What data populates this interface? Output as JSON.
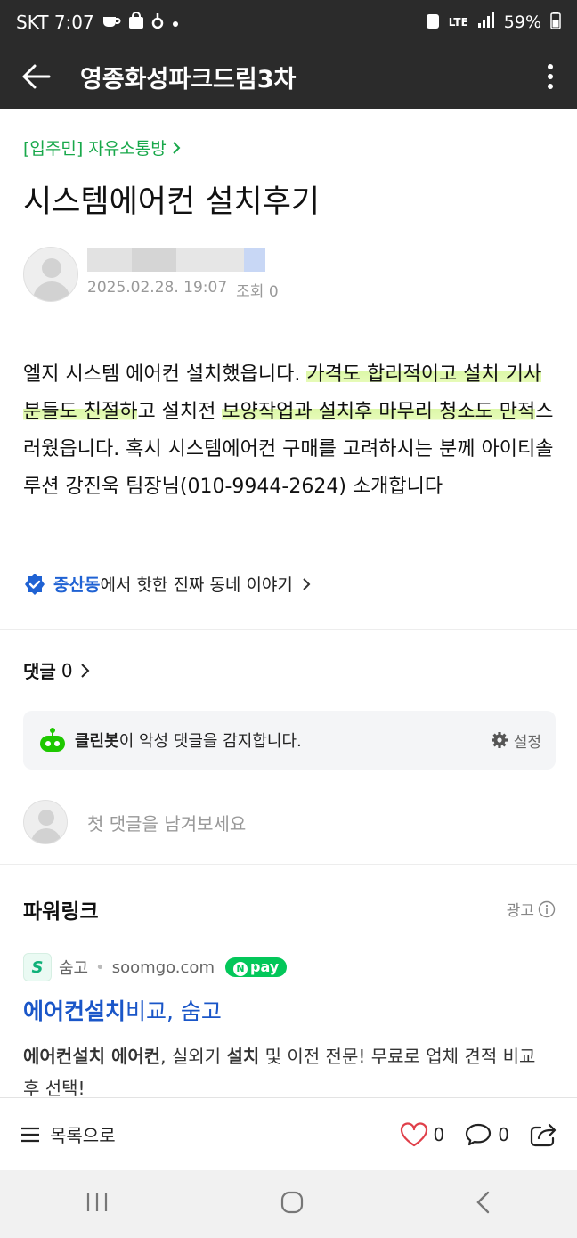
{
  "status_bar": {
    "carrier_time": "SKT 7:07",
    "network": "LTE",
    "battery": "59%"
  },
  "app_bar": {
    "title": "영종화성파크드림3차"
  },
  "post": {
    "breadcrumb": "[입주민] 자유소통방",
    "title": "시스템에어컨 설치후기",
    "date": "2025.02.28. 19:07",
    "views": "조회 0",
    "body": {
      "part1": "엘지 시스템 에어컨 설치했읍니다. ",
      "hl1": "가격도 합리적이고 설치 기사분들도 친절하",
      "part2": "고 설치전 ",
      "hl2": "보양작업과 설치후 마무리 청소도 만적",
      "part3": "스러웠읍니다. 혹시 시스템에어컨 구매를 고려하시는 분께 아이티솔루션 강진욱 팀장님(010-9944-2624) 소개합니다"
    },
    "neighborhood": {
      "name": "중산동",
      "text": "에서 핫한 진짜 동네 이야기"
    }
  },
  "comments": {
    "label": "댓글",
    "count": "0",
    "cleanbot_name": "클린봇",
    "cleanbot_text": "이 악성 댓글을 감지합니다.",
    "settings_label": "설정",
    "input_placeholder": "첫 댓글을 남겨보세요"
  },
  "powerlink": {
    "title": "파워링크",
    "ad_label": "광고",
    "advertiser": "숨고",
    "domain": "soomgo.com",
    "npay_label": "pay",
    "ad_title_bold": "에어컨설치",
    "ad_title_rest": "비교, 숨고",
    "desc_b1": "에어컨설치 에어컨",
    "desc_t1": ", 실외기 ",
    "desc_b2": "설치",
    "desc_t2": " 및 이전 전문! 무료로 업체 견적 비교 후 선택!"
  },
  "bottom_bar": {
    "list_label": "목록으로",
    "likes": "0",
    "comment_count": "0"
  },
  "colors": {
    "appbar_bg": "#2b2b2b",
    "breadcrumb_green": "#18a84a",
    "highlight": "#dcf7a8",
    "link_blue": "#1a56c8",
    "heart_red": "#e0404a"
  },
  "icons": [
    "back-arrow-icon",
    "more-vert-icon",
    "verified-check-icon",
    "chevron-right-icon",
    "cleanbot-robot-icon",
    "gear-icon",
    "info-icon",
    "menu-list-icon",
    "heart-icon",
    "comment-bubble-icon",
    "share-icon"
  ]
}
